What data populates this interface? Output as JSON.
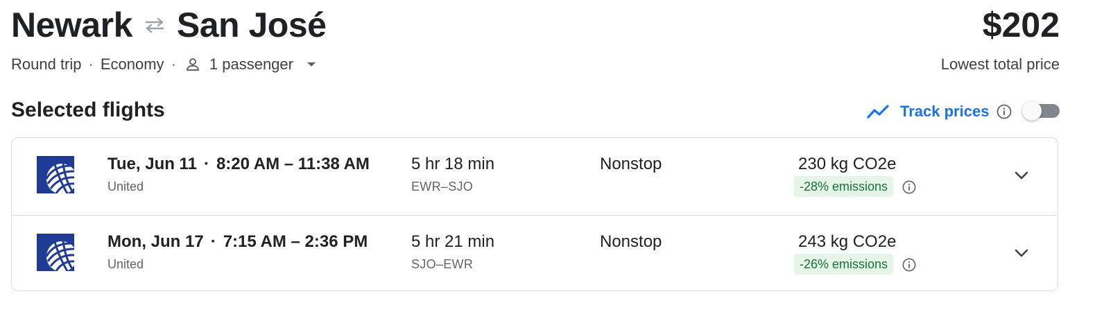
{
  "header": {
    "origin": "Newark",
    "destination": "San José",
    "trip_type": "Round trip",
    "cabin": "Economy",
    "passengers": "1 passenger",
    "separator": "·",
    "price": "$202",
    "price_label": "Lowest total price"
  },
  "selected": {
    "title": "Selected flights",
    "track_label": "Track prices",
    "track_enabled": false
  },
  "flights": [
    {
      "date": "Tue, Jun 11",
      "times": "8:20 AM – 11:38 AM",
      "airline": "United",
      "duration": "5 hr 18 min",
      "airports": "EWR–SJO",
      "stops": "Nonstop",
      "co2": "230 kg CO2e",
      "emissions": "-28% emissions"
    },
    {
      "date": "Mon, Jun 17",
      "times": "7:15 AM – 2:36 PM",
      "airline": "United",
      "duration": "5 hr 21 min",
      "airports": "SJO–EWR",
      "stops": "Nonstop",
      "co2": "243 kg CO2e",
      "emissions": "-26% emissions"
    }
  ],
  "colors": {
    "accent": "#1a73e8",
    "united_blue": "#1f3b94",
    "emissions_bg": "#e6f4ea",
    "emissions_text": "#137333"
  },
  "icons": {
    "swap": "swap-arrows-icon",
    "person": "person-icon",
    "dropdown": "caret-down-icon",
    "trend": "trending-line-icon",
    "info": "info-icon",
    "expand": "chevron-down-icon",
    "airline_logo": "united-globe-logo"
  }
}
